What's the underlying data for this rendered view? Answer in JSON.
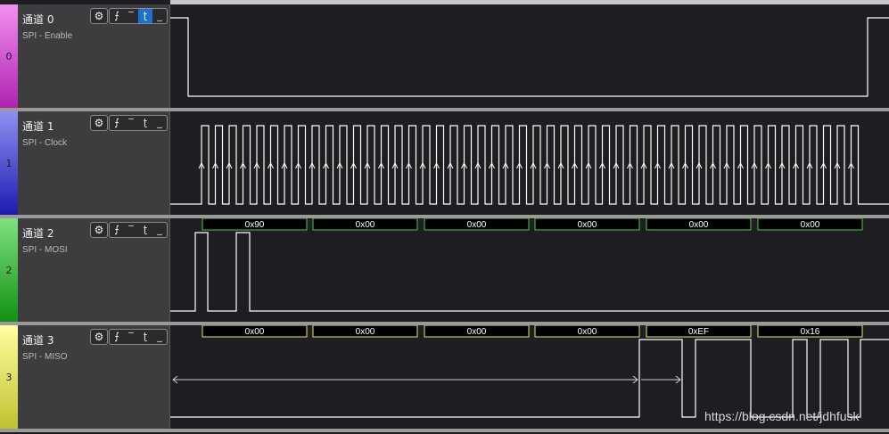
{
  "channels": [
    {
      "strip_label": "0",
      "title": "通道 0",
      "subtitle": "SPI - Enable",
      "strip_color": "#d050d0",
      "active_trigger": 2
    },
    {
      "strip_label": "1",
      "title": "通道 1",
      "subtitle": "SPI - Clock",
      "strip_color": "#4a4ae0",
      "active_trigger": -1
    },
    {
      "strip_label": "2",
      "title": "通道 2",
      "subtitle": "SPI - MOSI",
      "strip_color": "#38c838",
      "active_trigger": -1
    },
    {
      "strip_label": "3",
      "title": "通道 3",
      "subtitle": "SPI - MISO",
      "strip_color": "#e8e870",
      "active_trigger": -1
    }
  ],
  "toolbar_icons": [
    "gear-icon",
    "rising-edge-icon",
    "high-level-icon",
    "falling-edge-icon",
    "low-level-icon"
  ],
  "toolbar_glyphs": {
    "gear": "⚙",
    "rising": "⨍",
    "high": "‾",
    "falling": "ʈ",
    "low": "_"
  },
  "mosi_bytes": [
    "0x90",
    "0x00",
    "0x00",
    "0x00",
    "0x00",
    "0x00"
  ],
  "miso_bytes": [
    "0x00",
    "0x00",
    "0x00",
    "0x00",
    "0xEF",
    "0x16"
  ],
  "watermark": "https://blog.csdn.net/jdhfusk",
  "colors": {
    "wave": "#ffffff",
    "byte_box_border": "#44cc44",
    "byte_box_fill": "#000000",
    "miso_box_border": "#e8e870"
  }
}
